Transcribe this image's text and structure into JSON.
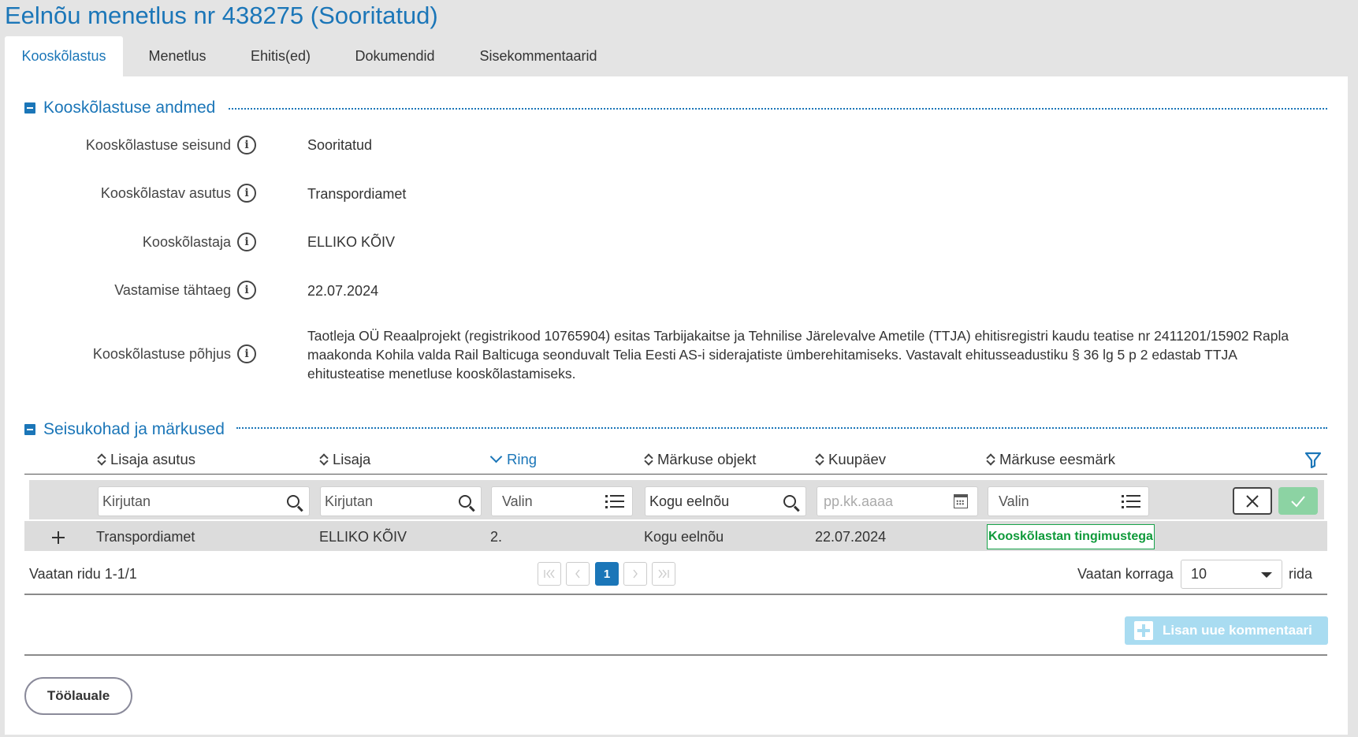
{
  "page_title": "Eelnõu menetlus nr 438275 (Sooritatud)",
  "tabs": [
    {
      "label": "Kooskõlastus",
      "active": true
    },
    {
      "label": "Menetlus",
      "active": false
    },
    {
      "label": "Ehitis(ed)",
      "active": false
    },
    {
      "label": "Dokumendid",
      "active": false
    },
    {
      "label": "Sisekommentaarid",
      "active": false
    }
  ],
  "section1": {
    "title": "Kooskõlastuse andmed",
    "fields": [
      {
        "label": "Kooskõlastuse seisund",
        "value": "Sooritatud"
      },
      {
        "label": "Kooskõlastav asutus",
        "value": "Transpordiamet"
      },
      {
        "label": "Kooskõlastaja",
        "value": "ELLIKO KÕIV"
      },
      {
        "label": "Vastamise tähtaeg",
        "value": "22.07.2024"
      },
      {
        "label": "Kooskõlastuse põhjus",
        "value": "Taotleja OÜ Reaalprojekt (registrikood 10765904) esitas Tarbijakaitse ja Tehnilise Järelevalve Ametile (TTJA) ehitisregistri kaudu teatise nr 2411201/15902 Rapla maakonda Kohila valda Rail Balticuga seonduvalt Telia Eesti AS-i siderajatiste ümberehitamiseks. Vastavalt ehitusseadustiku § 36 lg 5 p 2 edastab TTJA ehitusteatise menetluse kooskõlastamiseks."
      }
    ],
    "info_icon": "info-icon"
  },
  "section2": {
    "title": "Seisukohad ja märkused",
    "columns": [
      "Lisaja asutus",
      "Lisaja",
      "Ring",
      "Märkuse objekt",
      "Kuupäev",
      "Märkuse eesmärk"
    ],
    "sorted_column": "Ring",
    "filters": [
      {
        "placeholder": "Kirjutan",
        "icon": "search-icon"
      },
      {
        "placeholder": "Kirjutan",
        "icon": "search-icon"
      },
      {
        "placeholder": "Valin",
        "icon": "list-icon"
      },
      {
        "value": "Kogu eelnõu",
        "icon": "search-icon"
      },
      {
        "placeholder": "pp.kk.aaaa",
        "icon": "calendar-icon"
      },
      {
        "placeholder": "Valin",
        "icon": "list-icon"
      }
    ],
    "rows": [
      {
        "asutus": "Transpordiamet",
        "lisaja": "ELLIKO KÕIV",
        "ring": "2.",
        "objekt": "Kogu eelnõu",
        "kuupaev": "22.07.2024",
        "eesmark": "Kooskõlastan tingimustega"
      }
    ],
    "badge_color": "#17a34a",
    "pager": {
      "info": "Vaatan ridu 1-1/1",
      "current_page": "1",
      "rows_label": "Vaatan korraga",
      "rows_value": "10",
      "rows_suffix": "rida"
    },
    "add_button": "Lisan uue kommentaari"
  },
  "footer": {
    "home_button": "Töölauale"
  },
  "colors": {
    "accent": "#1b76b8",
    "confirm": "#8cd3a3",
    "add_button_bg": "#a9dcf1"
  }
}
